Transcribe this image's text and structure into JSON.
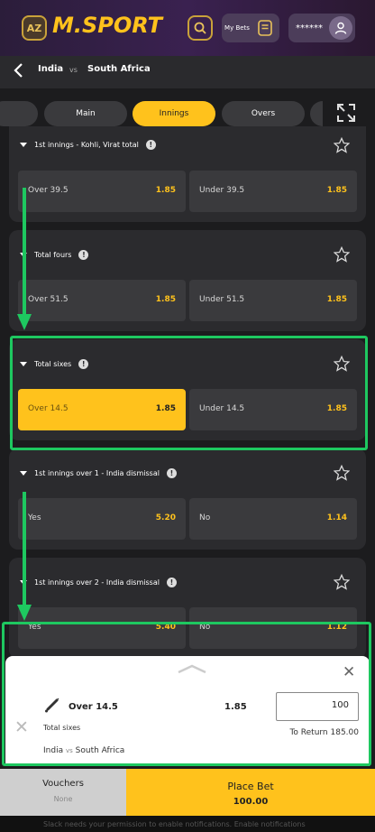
{
  "header": {
    "az_label": "AZ",
    "logo": "M.SPORT",
    "my_bets_label": "My Bets",
    "account_masked": "******"
  },
  "match": {
    "team1": "India",
    "vs": "vs",
    "team2": "South Africa"
  },
  "tabs": [
    {
      "label": "Main",
      "active": false
    },
    {
      "label": "Innings",
      "active": true
    },
    {
      "label": "Overs",
      "active": false
    }
  ],
  "markets": [
    {
      "title": "1st innings - Kohli, Virat total",
      "selections": [
        {
          "name": "Over 39.5",
          "odds": "1.85"
        },
        {
          "name": "Under 39.5",
          "odds": "1.85"
        }
      ]
    },
    {
      "title": "Total fours",
      "selections": [
        {
          "name": "Over 51.5",
          "odds": "1.85"
        },
        {
          "name": "Under 51.5",
          "odds": "1.85"
        }
      ]
    },
    {
      "title": "Total sixes",
      "selections": [
        {
          "name": "Over 14.5",
          "odds": "1.85",
          "selected": true
        },
        {
          "name": "Under 14.5",
          "odds": "1.85"
        }
      ]
    },
    {
      "title": "1st innings over 1 - India dismissal",
      "selections": [
        {
          "name": "Yes",
          "odds": "5.20"
        },
        {
          "name": "No",
          "odds": "1.14"
        }
      ]
    },
    {
      "title": "1st innings over 2 - India dismissal",
      "selections": [
        {
          "name": "Yes",
          "odds": "5.40"
        },
        {
          "name": "No",
          "odds": "1.12"
        }
      ]
    }
  ],
  "betslip": {
    "selection": "Over 14.5",
    "odds": "1.85",
    "market": "Total sixes",
    "event_team1": "India",
    "event_vs": "vs",
    "event_team2": "South Africa",
    "stake": "100",
    "to_return": "To Return 185.00"
  },
  "footer": {
    "vouchers_label": "Vouchers",
    "vouchers_value": "None",
    "place_bet_label": "Place Bet",
    "place_bet_amount": "100.00"
  },
  "notification": "Slack needs your permission to enable notifications. Enable notifications",
  "colors": {
    "accent": "#ffc21c",
    "annotation_green": "#1ec860",
    "background": "#1c1c1e",
    "card": "#2b2b2e"
  }
}
